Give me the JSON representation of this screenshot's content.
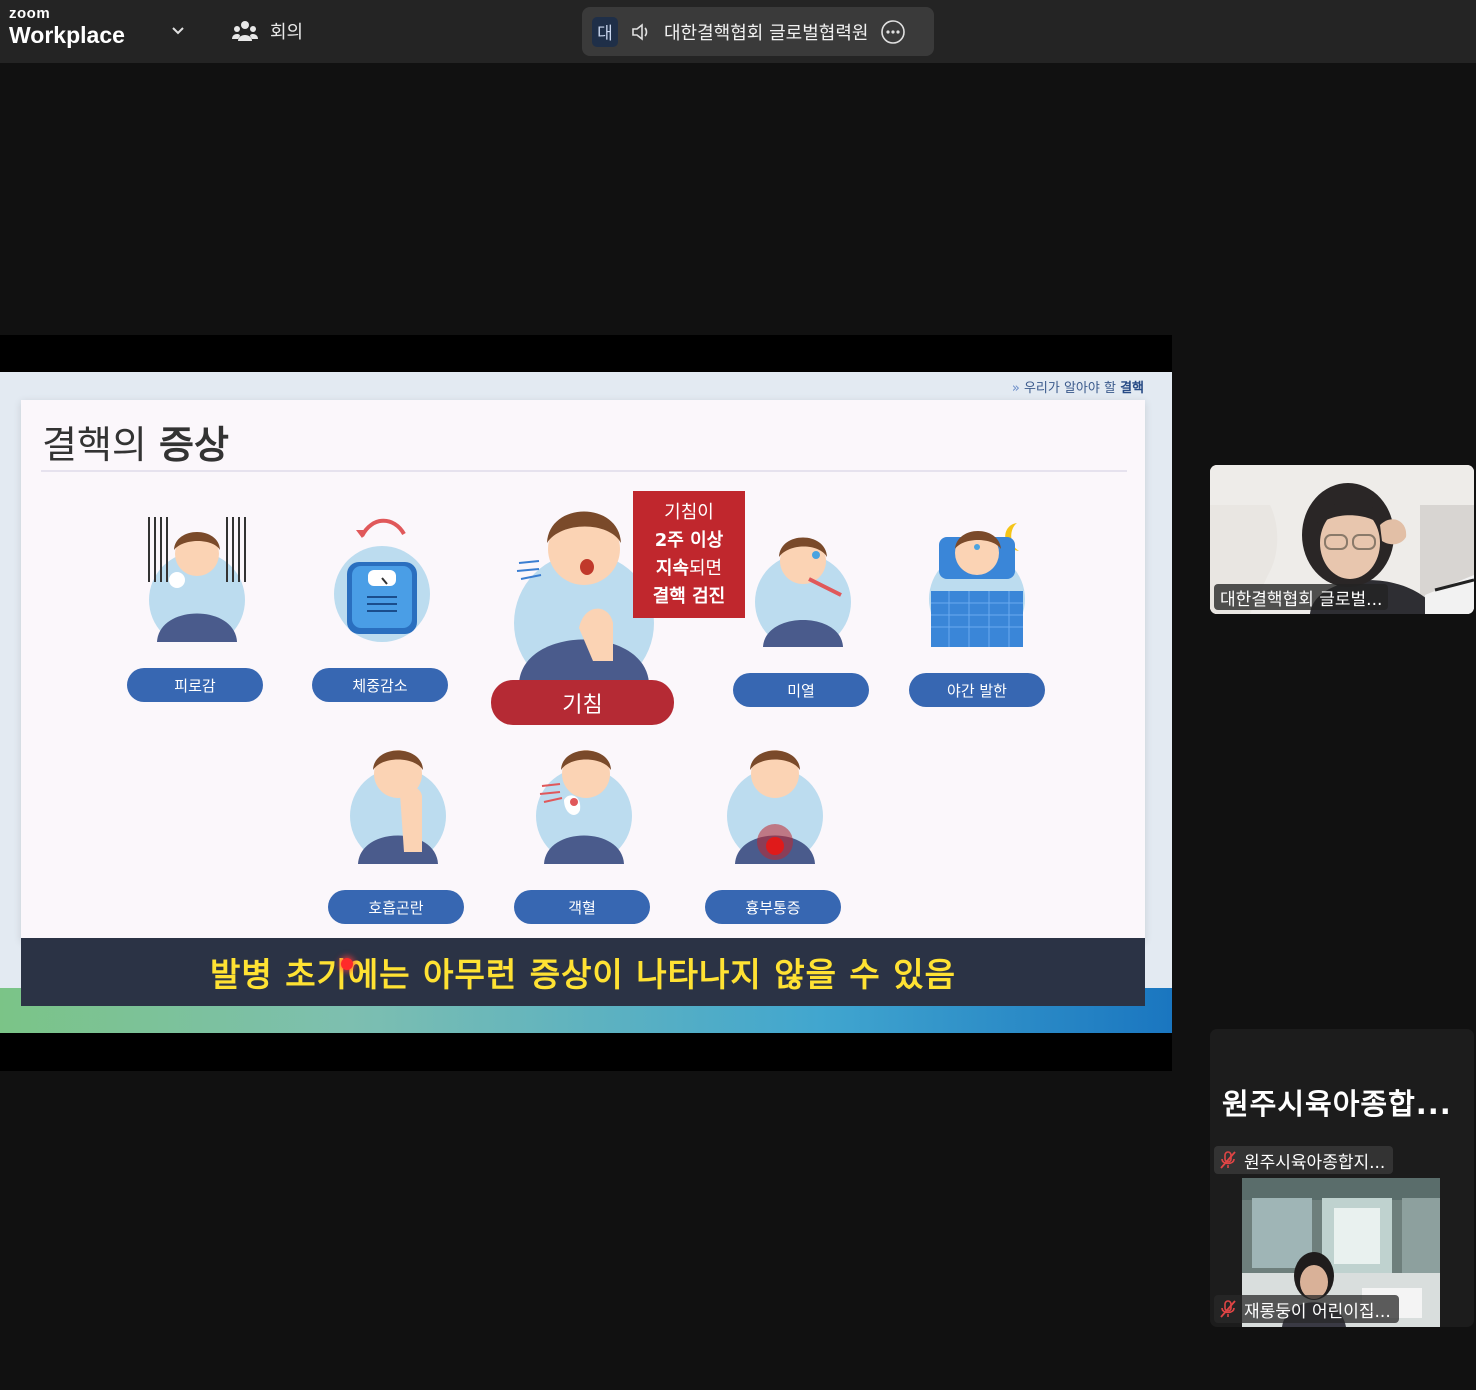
{
  "topbar": {
    "brand_small": "zoom",
    "brand_large": "Workplace",
    "meeting_label": "회의",
    "speaker_badge": "대",
    "active_speaker": "대한결핵협회 글로벌협력원"
  },
  "slide": {
    "header_prefix": "우리가 알아야 할",
    "header_bold": "결핵",
    "title_light": "결핵의",
    "title_bold": "증상",
    "symptoms_row1": [
      "피로감",
      "체중감소",
      "기침",
      "미열",
      "야간 발한"
    ],
    "symptoms_row2": [
      "호흡곤란",
      "객혈",
      "흉부통증"
    ],
    "cough_note": {
      "line1": "기침이",
      "line2": "2주 이상",
      "line3_bold": "지속",
      "line3_rest": "되면",
      "line4": "결핵 검진"
    },
    "caption": "발병 초기에는 아무런 증상이 나타나지 않을 수 있음"
  },
  "participants": {
    "speaker_tile_name": "대한결핵협회 글로벌...",
    "group_title": "원주시육아종합...",
    "group_member_1": "원주시육아종합지...",
    "group_member_2": "재롱둥이 어린이집..."
  },
  "colors": {
    "topbar": "#242424",
    "label_blue": "#3767b2",
    "label_red": "#b52a34",
    "caption_bg": "#2b3345",
    "caption_text": "#ffe233"
  }
}
